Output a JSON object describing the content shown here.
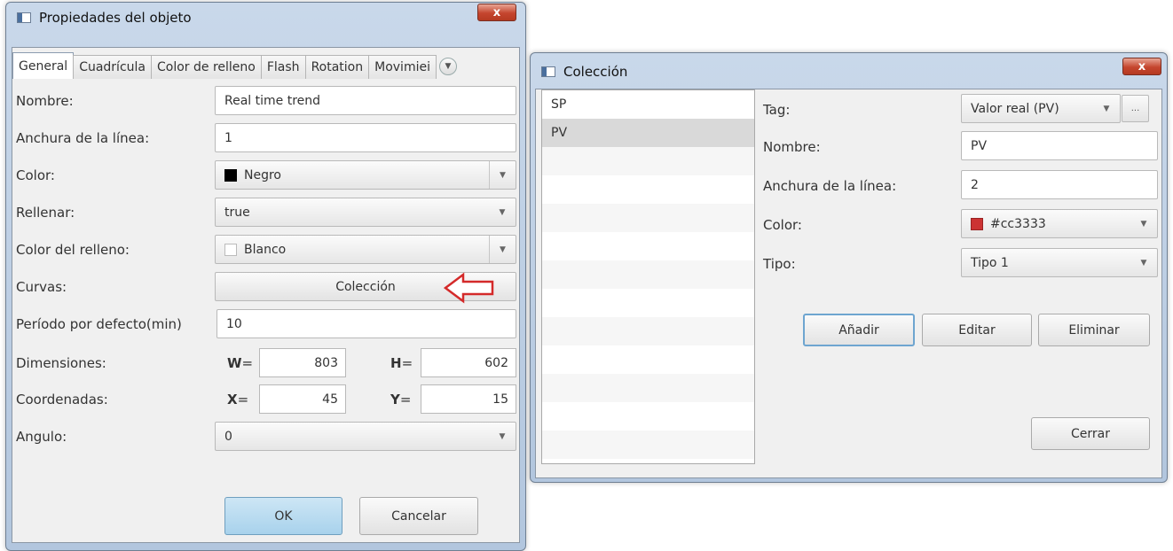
{
  "left_window": {
    "title": "Propiedades del objeto",
    "close_glyph": "x",
    "tabs": [
      "General",
      "Cuadrícula",
      "Color de relleno",
      "Flash",
      "Rotation",
      "Movimiei"
    ],
    "fields": {
      "nombre": {
        "label": "Nombre:",
        "value": "Real time trend"
      },
      "anchura": {
        "label": "Anchura de la línea:",
        "value": "1"
      },
      "color": {
        "label": "Color:",
        "value": "Negro",
        "swatch": "#000000"
      },
      "rellenar": {
        "label": "Rellenar:",
        "value": "true"
      },
      "color_relleno": {
        "label": "Color del relleno:",
        "value": "Blanco",
        "swatch": "#ffffff"
      },
      "curvas": {
        "label": "Curvas:",
        "button": "Colección"
      },
      "periodo": {
        "label": "Período por defecto(min)",
        "value": "10"
      },
      "dimensiones": {
        "label": "Dimensiones:",
        "w_label": "W",
        "w": "803",
        "h_label": "H",
        "h": "602"
      },
      "coordenadas": {
        "label": "Coordenadas:",
        "x_label": "X",
        "x": "45",
        "y_label": "Y",
        "y": "15"
      },
      "angulo": {
        "label": "Angulo:",
        "value": "0"
      }
    },
    "eq": "=",
    "ok": "OK",
    "cancel": "Cancelar"
  },
  "right_window": {
    "title": "Colección",
    "close_glyph": "x",
    "list": [
      "SP",
      "PV"
    ],
    "selected_index": 1,
    "form": {
      "tag": {
        "label": "Tag:",
        "value": "Valor real (PV)",
        "more": "..."
      },
      "nombre": {
        "label": "Nombre:",
        "value": "PV"
      },
      "anchura": {
        "label": "Anchura de la línea:",
        "value": "2"
      },
      "color": {
        "label": "Color:",
        "value": "#cc3333",
        "swatch": "#cc3333"
      },
      "tipo": {
        "label": "Tipo:",
        "value": "Tipo 1"
      }
    },
    "add": "Añadir",
    "edit": "Editar",
    "delete": "Eliminar",
    "close": "Cerrar"
  },
  "colors": {
    "annotation_arrow": "#d42a2a",
    "ok_button": "#a8d2ec"
  }
}
